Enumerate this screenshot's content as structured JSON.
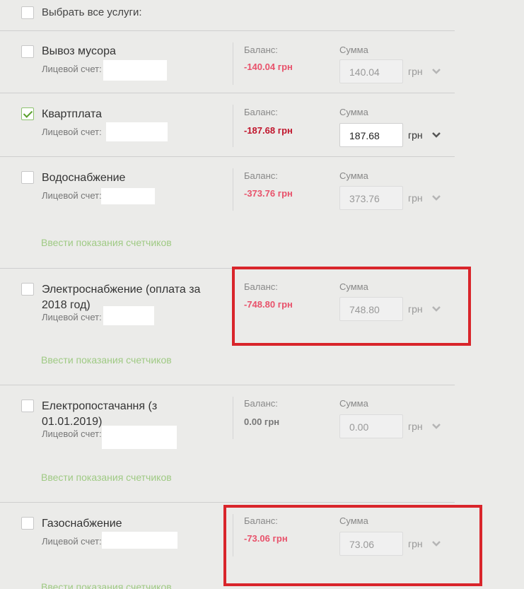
{
  "header": {
    "select_all_label": "Выбрать все услуги:"
  },
  "labels": {
    "balance": "Баланс:",
    "sum": "Сумма",
    "account": "Лицевой счет:",
    "currency": "грн",
    "meter_link": "Ввести показания счетчиков"
  },
  "services": [
    {
      "name": "Вывоз мусора",
      "checked": false,
      "balance": "-140.04 грн",
      "amount": "140.04"
    },
    {
      "name": "Квартплата",
      "checked": true,
      "balance": "-187.68 грн",
      "amount": "187.68"
    },
    {
      "name": "Водоснабжение",
      "checked": false,
      "balance": "-373.76 грн",
      "amount": "373.76"
    },
    {
      "name_line1": "Электроснабжение (оплата за",
      "name_line2": "2018 год)",
      "checked": false,
      "balance": "-748.80 грн",
      "amount": "748.80"
    },
    {
      "name_line1": "Електропостачання (з",
      "name_line2": "01.01.2019)",
      "checked": false,
      "balance": "0.00 грн",
      "amount": "0.00"
    },
    {
      "name": "Газоснабжение",
      "checked": false,
      "balance": "-73.06 грн",
      "amount": "73.06"
    }
  ],
  "colors": {
    "debt_balance": "#e8526b",
    "active_balance": "#c0152c",
    "link": "#9fca84",
    "highlight_box": "#d9252b"
  }
}
